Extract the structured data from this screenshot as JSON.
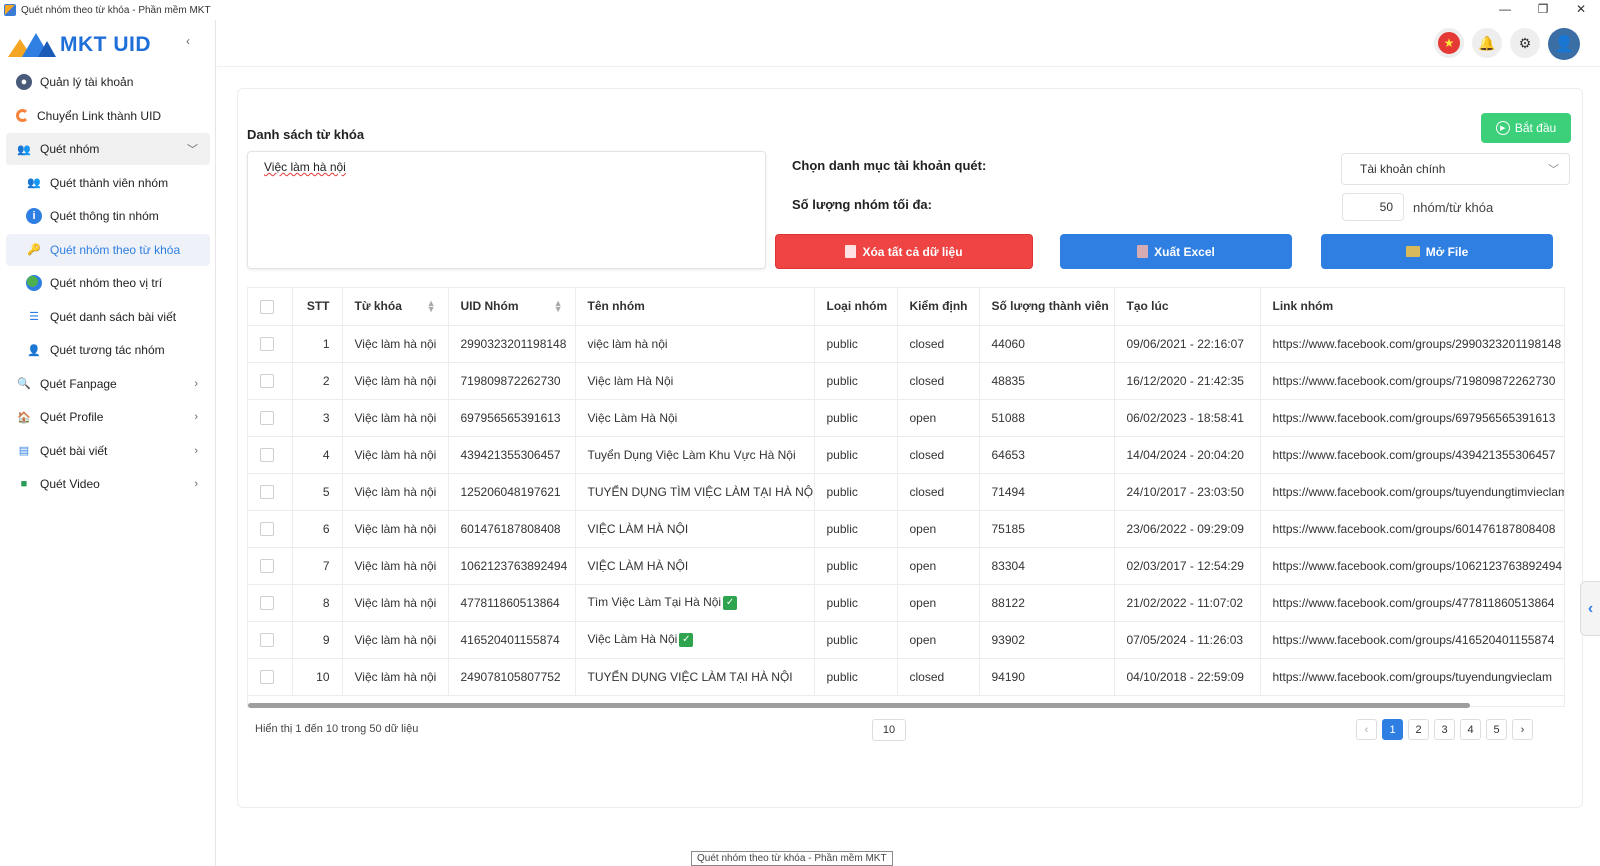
{
  "window": {
    "title": "Quét nhóm theo từ khóa - Phần mềm MKT",
    "controls": [
      "—",
      "❐",
      "✕"
    ]
  },
  "brand": {
    "name": "MKT UID"
  },
  "sidebar": {
    "collapse_icon": "‹",
    "items": [
      {
        "label": "Quản lý tài khoản",
        "icon": "user-icon"
      },
      {
        "label": "Chuyển Link thành UID",
        "icon": "link-icon"
      },
      {
        "label": "Quét nhóm",
        "icon": "group-icon"
      },
      {
        "label": "Quét thành viên nhóm",
        "icon": "members-icon"
      },
      {
        "label": "Quét thông tin nhóm",
        "icon": "info-icon"
      },
      {
        "label": "Quét nhóm theo từ khóa",
        "icon": "key-icon"
      },
      {
        "label": "Quét nhóm theo vị trí",
        "icon": "globe-icon"
      },
      {
        "label": "Quét danh sách bài viết",
        "icon": "list-icon"
      },
      {
        "label": "Quét tương tác nhóm",
        "icon": "interaction-icon"
      },
      {
        "label": "Quét Fanpage",
        "icon": "search-icon"
      },
      {
        "label": "Quét Profile",
        "icon": "profile-icon"
      },
      {
        "label": "Quét bài viết",
        "icon": "post-icon"
      },
      {
        "label": "Quét Video",
        "icon": "video-icon"
      }
    ]
  },
  "form": {
    "keywords_title": "Danh sách từ khóa",
    "keywords_value": "Việc làm hà nội",
    "start_label": "Bắt đầu",
    "category_label": "Chọn danh mục tài khoản quét:",
    "category_value": "Tài khoản chính",
    "max_label": "Số lượng nhóm tối đa:",
    "max_value": "50",
    "max_unit": "nhóm/từ khóa",
    "clear_label": "Xóa tất cả dữ liệu",
    "excel_label": "Xuất Excel",
    "open_label": "Mở File"
  },
  "table": {
    "headers": [
      "STT",
      "Từ khóa",
      "UID Nhóm",
      "Tên nhóm",
      "Loại nhóm",
      "Kiểm định",
      "Số lượng thành viên",
      "Tạo lúc",
      "Link nhóm"
    ],
    "rows": [
      {
        "stt": "1",
        "kw": "Việc làm hà nội",
        "uid": "2990323201198148",
        "name": "việc làm hà nội",
        "type": "public",
        "status": "closed",
        "members": "44060",
        "created": "09/06/2021 - 22:16:07",
        "link": "https://www.facebook.com/groups/2990323201198148"
      },
      {
        "stt": "2",
        "kw": "Việc làm hà nội",
        "uid": "719809872262730",
        "name": "Việc làm Hà Nội",
        "type": "public",
        "status": "closed",
        "members": "48835",
        "created": "16/12/2020 - 21:42:35",
        "link": "https://www.facebook.com/groups/719809872262730"
      },
      {
        "stt": "3",
        "kw": "Việc làm hà nội",
        "uid": "697956565391613",
        "name": "Việc Làm Hà Nội",
        "type": "public",
        "status": "open",
        "members": "51088",
        "created": "06/02/2023 - 18:58:41",
        "link": "https://www.facebook.com/groups/697956565391613"
      },
      {
        "stt": "4",
        "kw": "Việc làm hà nội",
        "uid": "439421355306457",
        "name": "Tuyển Dụng Việc Làm Khu Vực Hà Nội",
        "type": "public",
        "status": "closed",
        "members": "64653",
        "created": "14/04/2024 - 20:04:20",
        "link": "https://www.facebook.com/groups/439421355306457"
      },
      {
        "stt": "5",
        "kw": "Việc làm hà nội",
        "uid": "125206048197621",
        "name": "TUYỂN DỤNG TÌM VIỆC LÀM TẠI HÀ NỘI",
        "type": "public",
        "status": "closed",
        "members": "71494",
        "created": "24/10/2017 - 23:03:50",
        "link": "https://www.facebook.com/groups/tuyendungtimvieclam"
      },
      {
        "stt": "6",
        "kw": "Việc làm hà nội",
        "uid": "601476187808408",
        "name": "VIỆC LÀM HÀ NỘI",
        "type": "public",
        "status": "open",
        "members": "75185",
        "created": "23/06/2022 - 09:29:09",
        "link": "https://www.facebook.com/groups/601476187808408"
      },
      {
        "stt": "7",
        "kw": "Việc làm hà nội",
        "uid": "1062123763892494",
        "name": "VIỆC LÀM HÀ NỘI",
        "type": "public",
        "status": "open",
        "members": "83304",
        "created": "02/03/2017 - 12:54:29",
        "link": "https://www.facebook.com/groups/1062123763892494"
      },
      {
        "stt": "8",
        "kw": "Việc làm hà nội",
        "uid": "477811860513864",
        "name": "Tìm Việc Làm Tại Hà Nội",
        "check": "✓",
        "type": "public",
        "status": "open",
        "members": "88122",
        "created": "21/02/2022 - 11:07:02",
        "link": "https://www.facebook.com/groups/477811860513864"
      },
      {
        "stt": "9",
        "kw": "Việc làm hà nội",
        "uid": "416520401155874",
        "name": "Việc Làm Hà Nội",
        "check": "✓",
        "type": "public",
        "status": "open",
        "members": "93902",
        "created": "07/05/2024 - 11:26:03",
        "link": "https://www.facebook.com/groups/416520401155874"
      },
      {
        "stt": "10",
        "kw": "Việc làm hà nội",
        "uid": "249078105807752",
        "name": "TUYỂN DỤNG VIỆC LÀM TẠI HÀ NỘI",
        "type": "public",
        "status": "closed",
        "members": "94190",
        "created": "04/10/2018 - 22:59:09",
        "link": "https://www.facebook.com/groups/tuyendungvieclam"
      }
    ]
  },
  "footer": {
    "info": "Hiển thị 1 đến 10 trong 50 dữ liệu",
    "page_size": "10",
    "pages": [
      "1",
      "2",
      "3",
      "4",
      "5"
    ],
    "prev": "‹",
    "next": "›"
  },
  "tooltip": "Quét nhóm theo từ khóa - Phần mềm MKT",
  "colors": {
    "primary": "#2f7fe3",
    "danger": "#ef4444",
    "success": "#3dd07b"
  }
}
